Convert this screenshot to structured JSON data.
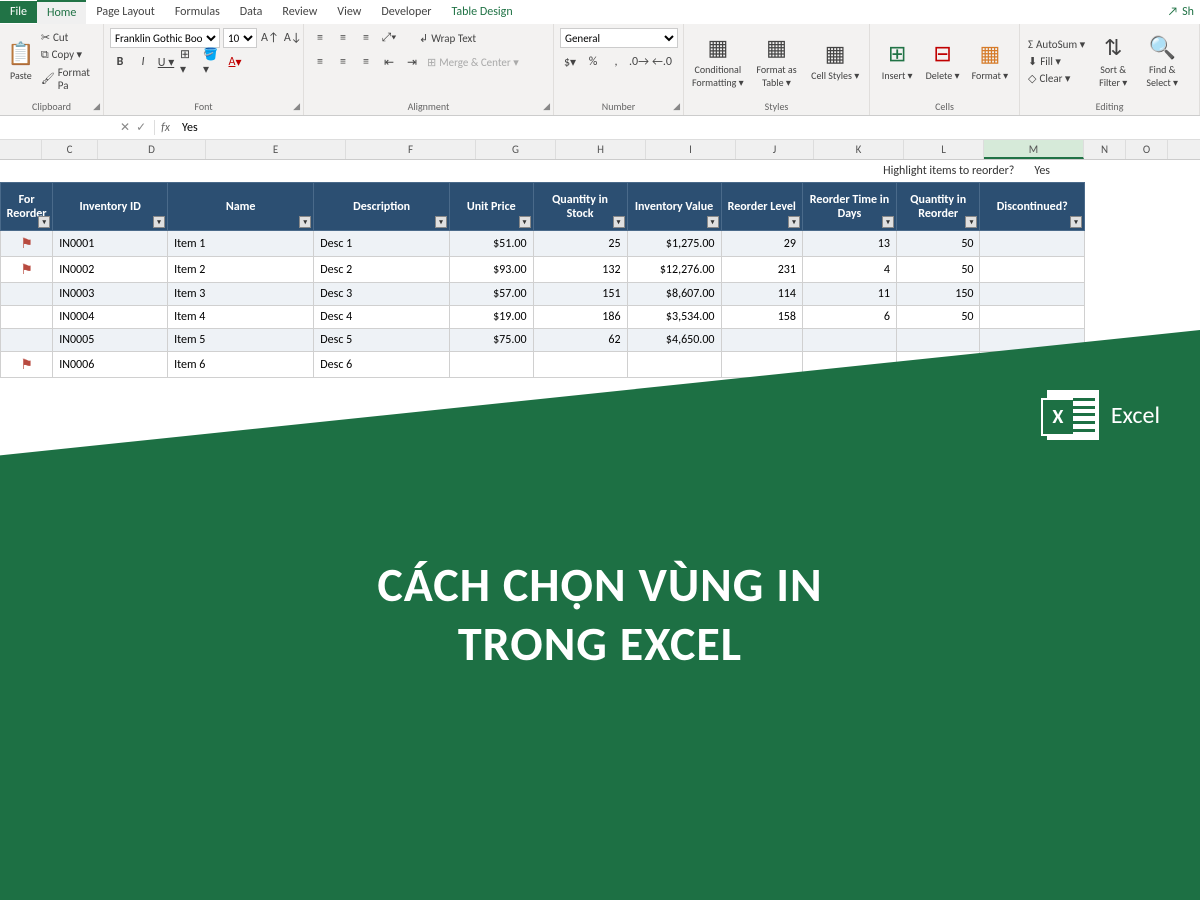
{
  "tabs": {
    "file": "File",
    "home": "Home",
    "page_layout": "Page Layout",
    "formulas": "Formulas",
    "data": "Data",
    "review": "Review",
    "view": "View",
    "developer": "Developer",
    "table_design": "Table Design",
    "share": "Sh"
  },
  "ribbon": {
    "clipboard": {
      "paste": "Paste",
      "cut": "Cut",
      "copy": "Copy ▾",
      "format_painter": "Format Pa",
      "label": "Clipboard"
    },
    "font": {
      "name": "Franklin Gothic Boo",
      "size": "10",
      "label": "Font"
    },
    "alignment": {
      "wrap": "Wrap Text",
      "merge": "Merge & Center ▾",
      "label": "Alignment"
    },
    "number": {
      "format": "General",
      "label": "Number"
    },
    "styles": {
      "cond": "Conditional Formatting ▾",
      "table": "Format as Table ▾",
      "cell": "Cell Styles ▾",
      "label": "Styles"
    },
    "cells": {
      "insert": "Insert ▾",
      "delete": "Delete ▾",
      "format": "Format ▾",
      "label": "Cells"
    },
    "editing": {
      "autosum": "AutoSum ▾",
      "fill": "Fill ▾",
      "clear": "Clear ▾",
      "sort": "Sort & Filter ▾",
      "find": "Find & Select ▾",
      "label": "Editing"
    }
  },
  "formula_bar": {
    "name_box": "",
    "value": "Yes"
  },
  "columns": [
    "",
    "C",
    "D",
    "E",
    "F",
    "G",
    "H",
    "I",
    "J",
    "K",
    "L",
    "M",
    "N",
    "O"
  ],
  "highlight_prompt": "Highlight items to reorder?",
  "highlight_answer": "Yes",
  "headers": [
    "For Reorder",
    "Inventory ID",
    "Name",
    "Description",
    "Unit Price",
    "Quantity in Stock",
    "Inventory Value",
    "Reorder Level",
    "Reorder Time in Days",
    "Quantity in Reorder",
    "Discontinued?"
  ],
  "rows": [
    {
      "flag": true,
      "id": "IN0001",
      "name": "Item 1",
      "desc": "Desc 1",
      "price": "$51.00",
      "qty": "25",
      "value": "$1,275.00",
      "reorder": "29",
      "days": "13",
      "qre": "50",
      "disc": ""
    },
    {
      "flag": true,
      "id": "IN0002",
      "name": "Item 2",
      "desc": "Desc 2",
      "price": "$93.00",
      "qty": "132",
      "value": "$12,276.00",
      "reorder": "231",
      "days": "4",
      "qre": "50",
      "disc": ""
    },
    {
      "flag": false,
      "id": "IN0003",
      "name": "Item 3",
      "desc": "Desc 3",
      "price": "$57.00",
      "qty": "151",
      "value": "$8,607.00",
      "reorder": "114",
      "days": "11",
      "qre": "150",
      "disc": ""
    },
    {
      "flag": false,
      "id": "IN0004",
      "name": "Item 4",
      "desc": "Desc 4",
      "price": "$19.00",
      "qty": "186",
      "value": "$3,534.00",
      "reorder": "158",
      "days": "6",
      "qre": "50",
      "disc": ""
    },
    {
      "flag": false,
      "id": "IN0005",
      "name": "Item 5",
      "desc": "Desc 5",
      "price": "$75.00",
      "qty": "62",
      "value": "$4,650.00",
      "reorder": "",
      "days": "",
      "qre": "",
      "disc": ""
    },
    {
      "flag": true,
      "id": "IN0006",
      "name": "Item 6",
      "desc": "Desc 6",
      "price": "",
      "qty": "",
      "value": "",
      "reorder": "",
      "days": "",
      "qre": "",
      "disc": ""
    }
  ],
  "overlay": {
    "brand": "Excel",
    "title_line1": "CÁCH CHỌN VÙNG IN",
    "title_line2": "TRONG EXCEL"
  }
}
